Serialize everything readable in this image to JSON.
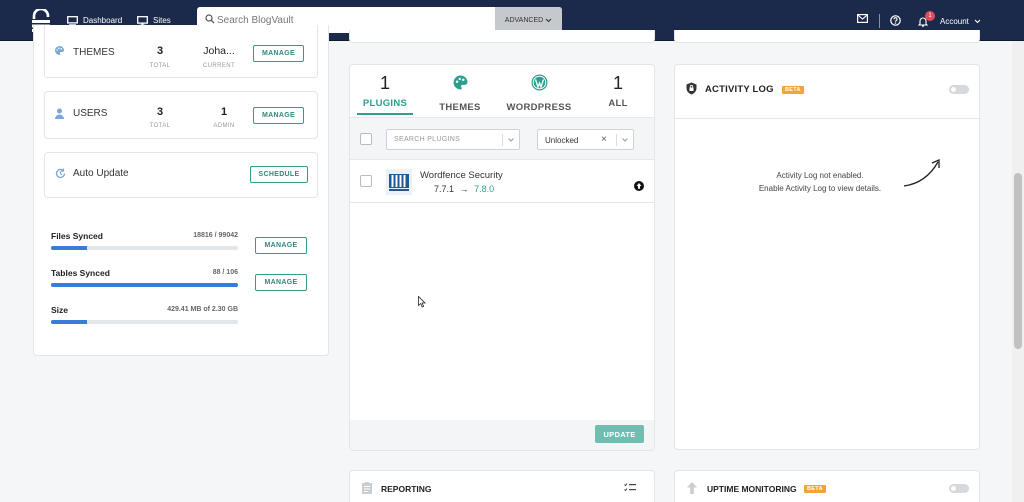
{
  "header": {
    "nav_dashboard": "Dashboard",
    "nav_sites": "Sites",
    "search_placeholder": "Search BlogVault",
    "advanced_label": "ADVANCED",
    "notification_count": "1",
    "account_label": "Account"
  },
  "left": {
    "themes": {
      "label": "THEMES",
      "total": "3",
      "total_label": "TOTAL",
      "current": "Joha...",
      "current_label": "CURRENT",
      "button": "MANAGE"
    },
    "users": {
      "label": "USERS",
      "total": "3",
      "total_label": "TOTAL",
      "admin": "1",
      "admin_label": "ADMIN",
      "button": "MANAGE"
    },
    "auto_update": {
      "label": "Auto Update",
      "button": "SCHEDULE"
    },
    "files": {
      "label": "Files Synced",
      "value": "18816 / 99042",
      "progress": 0.19,
      "button": "MANAGE"
    },
    "tables": {
      "label": "Tables Synced",
      "value": "88 / 106",
      "progress": 1.0,
      "button": "MANAGE"
    },
    "size": {
      "label": "Size",
      "value": "429.41 MB of 2.30 GB",
      "progress": 0.19
    }
  },
  "updates": {
    "tabs": [
      {
        "count": "1",
        "label": "PLUGINS",
        "active": true
      },
      {
        "label": "THEMES",
        "icon": "palette-icon"
      },
      {
        "label": "WORDPRESS",
        "icon": "wordpress-icon"
      },
      {
        "count": "1",
        "label": "ALL"
      }
    ],
    "search_placeholder": "SEARCH PLUGINS",
    "filter_value": "Unlocked",
    "plugin": {
      "name": "Wordfence Security",
      "current": "7.7.1",
      "arrow": "→",
      "new": "7.8.0"
    },
    "update_button": "UPDATE",
    "accent": "#2e9e8f"
  },
  "activity": {
    "title": "ACTIVITY LOG",
    "badge": "BETA",
    "msg1": "Activity Log not enabled.",
    "msg2": "Enable Activity Log to view details."
  },
  "reporting": {
    "title": "REPORTING"
  },
  "uptime": {
    "title": "UPTIME MONITORING",
    "badge": "BETA"
  }
}
